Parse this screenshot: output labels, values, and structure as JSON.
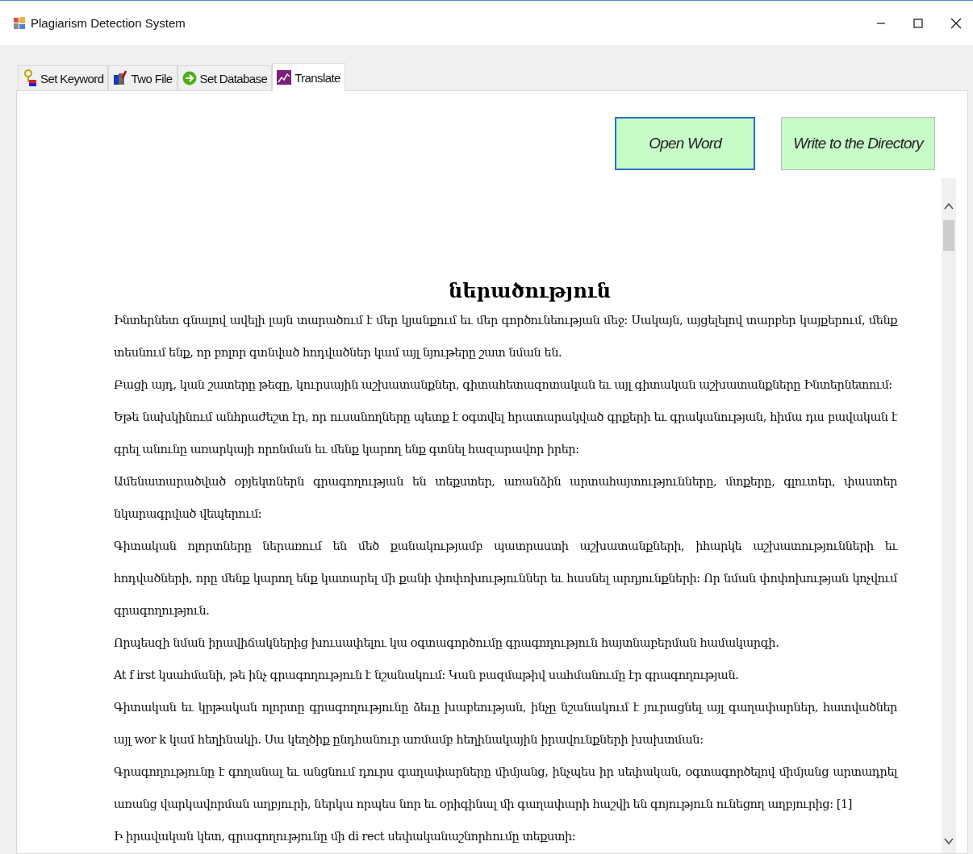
{
  "window": {
    "title": "Plagiarism Detection System"
  },
  "tabs": [
    {
      "label": "Set Keyword",
      "kind": "keyword",
      "selected": false
    },
    {
      "label": "Two File",
      "kind": "file",
      "selected": false
    },
    {
      "label": "Set Database",
      "kind": "database",
      "selected": false
    },
    {
      "label": "Translate",
      "kind": "translate",
      "selected": true
    }
  ],
  "buttons": [
    {
      "label": "Open Word",
      "focused": true
    },
    {
      "label": "Write to the Directory",
      "focused": false
    }
  ],
  "document": {
    "heading": "ներածություն",
    "paragraphs": [
      "Ինտերնետ գնալով ավելի լայն տարածում է մեր կյանքում եւ մեր գործունեության մեջ:  Սակայն, այցելելով տարբեր կայքերում, մենք տեսնում ենք, որ բոլոր գտնված հոդվածներ կամ այլ նյութերը շատ նման են.",
      "Բացի այդ, կան շատերը թեզը, կուրսային աշխատանքներ, գիտահետազոտական եւ այլ գիտական աշխատանքները Ինտերնետում:",
      "Եթե նախկինում անհրաժեշտ էր, որ ուսանողները պետք է օգտվել հրատարակված գրքերի եւ գրականության, հիմա դա բավական է գրել անունը առարկայի որոնման եւ մենք կարող ենք գտնել հազարավոր իրեր:",
      "Ամենատարածված օբյեկտներն գրագողության են տեքստեր, առանձին արտահայտությունները, մտքերը, գլուտեր, փաստեր նկարագրված վեպերում:",
      "Գիտական ոլորտները ներառում են մեծ քանակությամբ պատրաստի աշխատանքների, իհարկե աշխատությունների եւ հոդվածների, որը մենք կարող ենք կատարել մի քանի փոփոխություններ եւ հասնել արդյունքների:  Որ նման փոփոխության կոչվում գրագողություն.",
      "Որպեսզի նման իրավիճակներից խուսափելու կա օգտագործումը գրագողություն հայտնաբերման համակարգի.",
      "At f irst կսահմանի, թե ինչ գրագողություն է նշանակում:  Կան բազմաթիվ սահմանումը էր գրագողության.",
      "Գիտական եւ կրթական ոլորտը գրագողությունը ձեւը խաբեության, ինչը նշանակում է յուրացնել այլ գաղափարներ, հատվածներ այլ wor k կամ հեղինակի.  Սա կեղծիք ընդհանուր առմամբ հեղինակային իրավունքների խախտման:",
      "Գրագողությունը է գողանալ եւ անցնում դուրս գաղափարները միմյանց, ինչպես իր սեփական, օգտագործելով միմյանց արտադրել առանց վարկավորման աղբյուրի, ներկա որպես նոր եւ օրիգինալ մի գաղափարի հաշվի են գոյություն ունեցող աղբյուրից:  [1]",
      "Ի իրավական կետ, գրագողությունը մի di rect սեփականաշնորհումը տեքստի:"
    ]
  }
}
